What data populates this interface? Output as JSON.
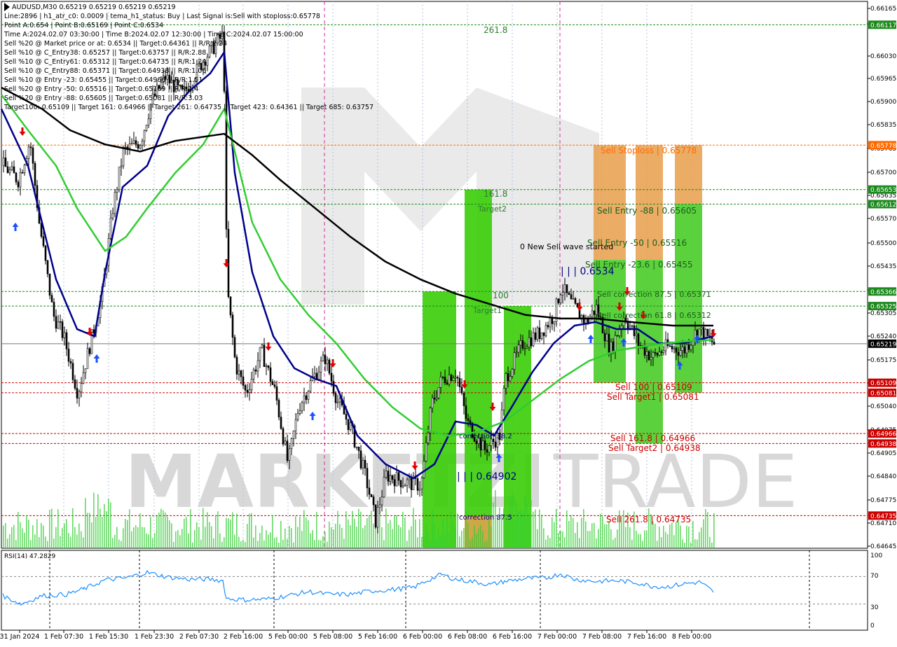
{
  "header": {
    "symbol_line": "AUDUSD,M30   0.65219 0.65219 0.65219 0.65219",
    "info_lines": [
      "Line:2896  |  h1_atr_c0: 0.0009  |  tema_h1_status: Buy  |  Last Signal is:Sell with stoploss:0.65778",
      "Point A:0.654  |  Point B:0.65169  |  Point C:0.6534",
      "Time A:2024.02.07 03:30:00  |  Time B:2024.02.07 12:30:00  |  Time C:2024.02.07 15:00:00",
      "Sell %20 @ Market price or at: 0.6534  ||  Target:0.64361  ||  R/R:2.24",
      "Sell %10 @ C_Entry38: 0.65257  ||  Target:0.63757  ||  R/R:2.88",
      "Sell %10 @ C_Entry61: 0.65312  ||  Target:0.64735  ||  R/R:1.24",
      "Sell %10 @ C_Entry88: 0.65371  ||  Target:0.64938  ||  R/R:1.06",
      "Sell %10 @ Entry -23: 0.65455  ||  Target:0.64966  ||  R/R:1.51",
      "Sell %20 @ Entry -50: 0.65516  ||  Target:0.65109  ||  R/R:1.4",
      "Sell %20 @ Entry -88: 0.65605  ||  Target:0.65081  ||  R/R:3.03",
      "Target100: 0.65109  ||  Target 161: 0.64966  ||  Target 261: 0.64735  ||  Target 423: 0.64361  ||  Target 685: 0.63757"
    ]
  },
  "watermark": {
    "left": "MARKETZI",
    "right": "TRADE"
  },
  "chart_data": {
    "type": "line",
    "title": "AUDUSD,M30",
    "ylim": [
      0.64645,
      0.66165
    ],
    "y_ticks": [
      "0.66165",
      "0.66085",
      "0.66030",
      "0.65965",
      "0.65900",
      "0.65835",
      "0.65765",
      "0.65700",
      "0.65635",
      "0.65570",
      "0.65500",
      "0.65435",
      "0.65370",
      "0.65305",
      "0.65240",
      "0.65175",
      "0.65105",
      "0.65040",
      "0.64975",
      "0.64905",
      "0.64840",
      "0.64775",
      "0.64710",
      "0.64645"
    ],
    "x_ticks": [
      "31 Jan 2024",
      "1 Feb 07:30",
      "1 Feb 15:30",
      "1 Feb 23:30",
      "2 Feb 07:30",
      "2 Feb 16:00",
      "5 Feb 00:00",
      "5 Feb 08:00",
      "5 Feb 16:00",
      "6 Feb 00:00",
      "6 Feb 08:00",
      "6 Feb 16:00",
      "7 Feb 00:00",
      "7 Feb 08:00",
      "7 Feb 16:00",
      "8 Feb 00:00"
    ],
    "current_price": "0.65219",
    "price_tags": [
      {
        "value": "0.66117",
        "color": "#1e8a1e"
      },
      {
        "value": "0.65778",
        "color": "#ff6a00"
      },
      {
        "value": "0.65653",
        "color": "#1e8a1e"
      },
      {
        "value": "0.65612",
        "color": "#1e8a1e"
      },
      {
        "value": "0.65366",
        "color": "#1e8a1e"
      },
      {
        "value": "0.65325",
        "color": "#1e8a1e"
      },
      {
        "value": "0.65109",
        "color": "#cc0000"
      },
      {
        "value": "0.65081",
        "color": "#cc0000"
      },
      {
        "value": "0.64966",
        "color": "#cc0000"
      },
      {
        "value": "0.64938",
        "color": "#cc0000"
      },
      {
        "value": "0.64735",
        "color": "#cc0000"
      }
    ],
    "level_labels": [
      {
        "text": "261.8",
        "color": "#2e7d32"
      },
      {
        "text": "161.8",
        "color": "#2e7d32"
      },
      {
        "text": "Target2",
        "color": "#2e7d32"
      },
      {
        "text": "100",
        "color": "#2e7d32"
      },
      {
        "text": "Target1",
        "color": "#2e7d32"
      },
      {
        "text": "0 New Sell wave started",
        "color": "#000000"
      },
      {
        "text": "| | | 0.6534",
        "color": "#000080"
      },
      {
        "text": "Sell Stoploss | 0.65778",
        "color": "#ff6a00"
      },
      {
        "text": "Sell Entry -88 | 0.65605",
        "color": "#1a5e1a"
      },
      {
        "text": "Sell Entry -50 | 0.65516",
        "color": "#1a5e1a"
      },
      {
        "text": "Sell Entry -23.6 | 0.65455",
        "color": "#1a5e1a"
      },
      {
        "text": "Sell correction 87.5 | 0.65371",
        "color": "#1a5e1a"
      },
      {
        "text": "Sell correction 61.8 | 0.65312",
        "color": "#1a5e1a"
      },
      {
        "text": "Sell 100 | 0.65109",
        "color": "#cc0000"
      },
      {
        "text": "Sell Target1 | 0.65081",
        "color": "#cc0000"
      },
      {
        "text": "Sell 161.8 | 0.64966",
        "color": "#cc0000"
      },
      {
        "text": "Sell Target2 | 0.64938",
        "color": "#cc0000"
      },
      {
        "text": "Sell 261.8 | 0.64735",
        "color": "#cc0000"
      },
      {
        "text": "correction 38.2",
        "color": "#000080"
      },
      {
        "text": "| | | 0.64902",
        "color": "#000080"
      },
      {
        "text": "correction 87.5",
        "color": "#000080"
      }
    ],
    "series": [
      {
        "name": "price",
        "color": "#000000"
      },
      {
        "name": "ema_fast",
        "color": "#00008b"
      },
      {
        "name": "ema_mid",
        "color": "#32cd32"
      },
      {
        "name": "ema_slow",
        "color": "#000000"
      }
    ]
  },
  "rsi": {
    "label": "RSI(14) 47.2829",
    "levels": [
      "100",
      "70",
      "30",
      "0"
    ],
    "color": "#1e90ff"
  }
}
